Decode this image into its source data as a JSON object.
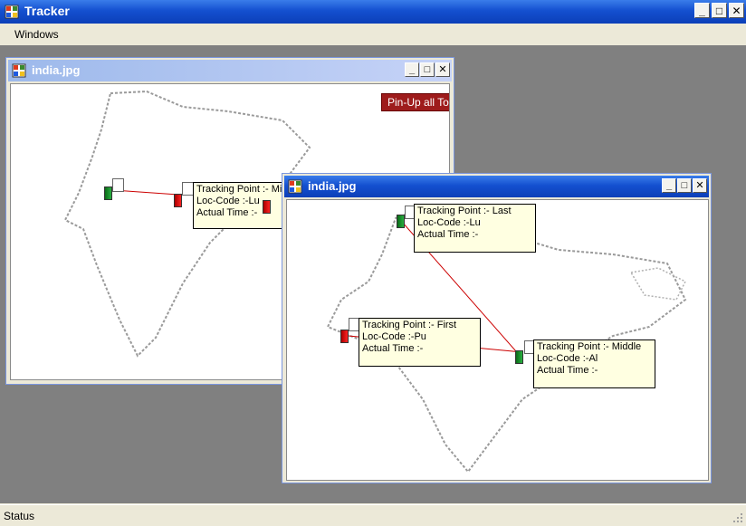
{
  "app": {
    "title": "Tracker"
  },
  "menu": {
    "windows": "Windows"
  },
  "status": {
    "text": "Status"
  },
  "windows": [
    {
      "title": "india.jpg",
      "pin_button": "Pin-Up all Tooltips",
      "points": [
        {
          "title": "Tracking Point :- Middle",
          "loc": "Loc-Code :-Lu",
          "time": "Actual Time :-"
        }
      ]
    },
    {
      "title": "india.jpg",
      "points": [
        {
          "title": "Tracking Point :- Last",
          "loc": "Loc-Code :-Lu",
          "time": "Actual Time :-"
        },
        {
          "title": "Tracking Point :- First",
          "loc": "Loc-Code :-Pu",
          "time": "Actual Time :-"
        },
        {
          "title": "Tracking Point :- Middle",
          "loc": "Loc-Code :-Al",
          "time": "Actual Time :-"
        }
      ]
    }
  ],
  "colors": {
    "titlebar": "#1450d0",
    "mdi_background": "#808080",
    "tooltip": "#ffffe1",
    "route_line": "#cc0000"
  },
  "icons": [
    "app-icon",
    "minimize-icon",
    "maximize-icon",
    "close-icon",
    "flag-icon",
    "size-grip-icon"
  ]
}
